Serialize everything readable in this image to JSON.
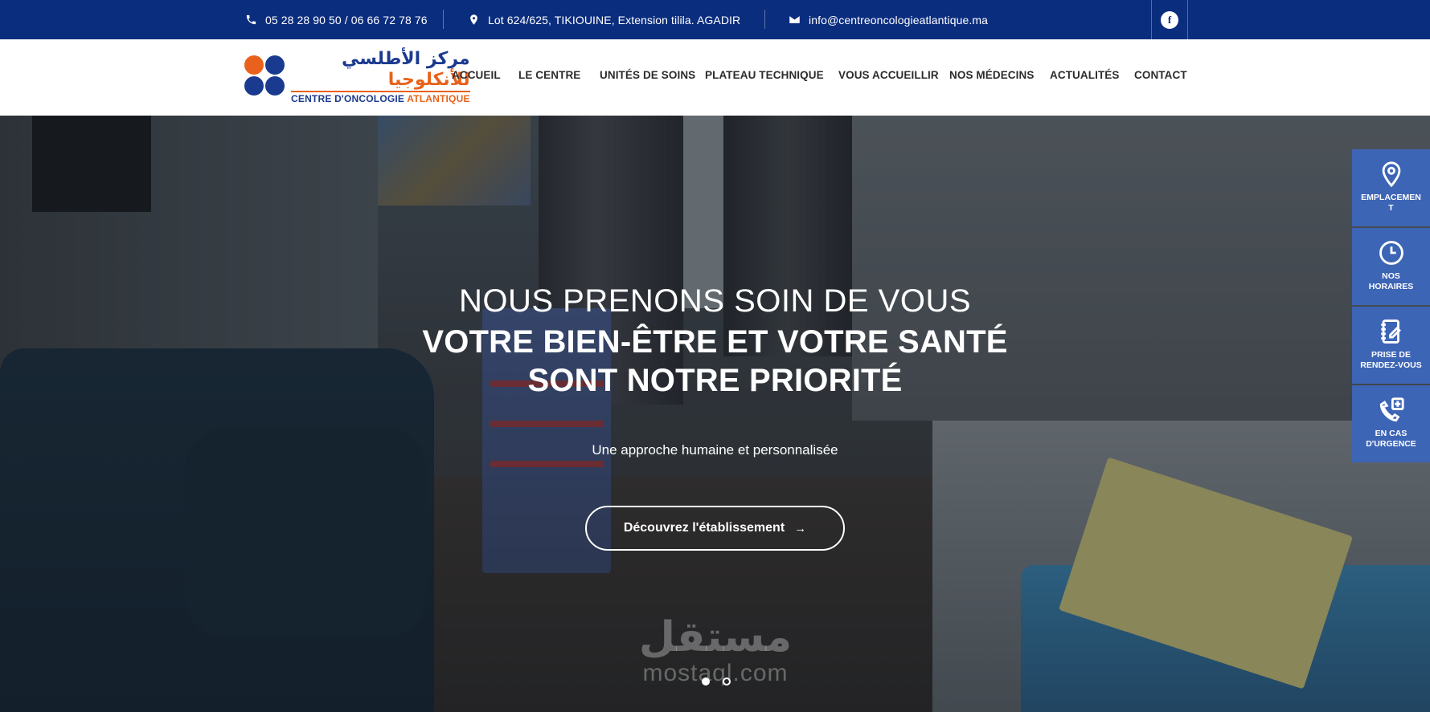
{
  "topbar": {
    "phone": "05 28 28 90 50 / 06 66 72 78 76",
    "address": "Lot 624/625, TIKIOUINE, Extension tilila. AGADIR",
    "email": "info@centreoncologieatlantique.ma",
    "facebook_icon": "f"
  },
  "logo": {
    "arabic_part1": "مركز الأطلسي",
    "arabic_part2": " للأنكلوجيا",
    "french_part1": "CENTRE D'ONCOLOGIE ",
    "french_part2": "ATLANTIQUE",
    "colors": {
      "blue": "#1a3a8f",
      "orange": "#e8621b"
    }
  },
  "nav": [
    {
      "label": "ACCUEIL"
    },
    {
      "label": "LE CENTRE"
    },
    {
      "label": "UNITÉS DE SOINS"
    },
    {
      "label": "PLATEAU TECHNIQUE"
    },
    {
      "label": "VOUS ACCUEILLIR"
    },
    {
      "label": "NOS MÉDECINS"
    },
    {
      "label": "ACTUALITÉS"
    },
    {
      "label": "CONTACT"
    }
  ],
  "hero": {
    "line1": "NOUS PRENONS SOIN DE VOUS",
    "line2": "VOTRE BIEN-ÊTRE ET VOTRE SANTÉ",
    "line3": "SONT NOTRE PRIORITÉ",
    "subtitle": "Une approche humaine et personnalisée",
    "button": "Découvrez l'établissement",
    "button_arrow": "→",
    "slides": 2,
    "active_slide": 1
  },
  "watermark": {
    "arabic": "مستقل",
    "latin": "mostaql.com"
  },
  "side_panel": [
    {
      "label": "EMPLACEMENT",
      "icon": "location-pin-icon"
    },
    {
      "label": "NOS HORAIRES",
      "icon": "clock-icon"
    },
    {
      "label": "PRISE DE RENDEZ-VOUS",
      "icon": "appointment-notebook-icon"
    },
    {
      "label": "EN CAS D'URGENCE",
      "icon": "emergency-phone-icon"
    }
  ],
  "colors": {
    "topbar_bg": "#0b2d7e",
    "side_panel_bg": "#3d65b6",
    "nav_text": "#2b2b2b"
  }
}
